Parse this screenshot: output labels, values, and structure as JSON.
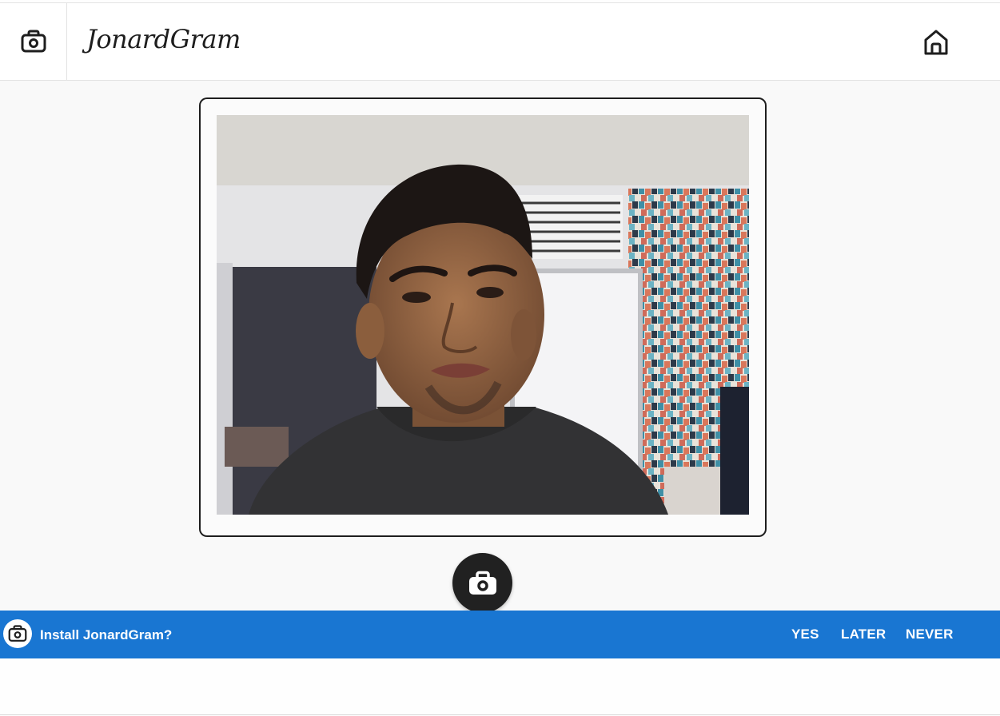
{
  "header": {
    "brand": "JonardGram",
    "camera_icon": "camera-icon",
    "home_icon": "home-icon"
  },
  "camera_view": {
    "description_icon": "webcam-feed",
    "shutter_icon": "camera-icon"
  },
  "install_banner": {
    "icon": "camera-icon",
    "prompt": "Install JonardGram?",
    "yes_label": "YES",
    "later_label": "LATER",
    "never_label": "NEVER",
    "color": "#1976d2"
  },
  "colors": {
    "accent": "#1976d2",
    "dark": "#212121",
    "background": "#f9f9f9"
  }
}
